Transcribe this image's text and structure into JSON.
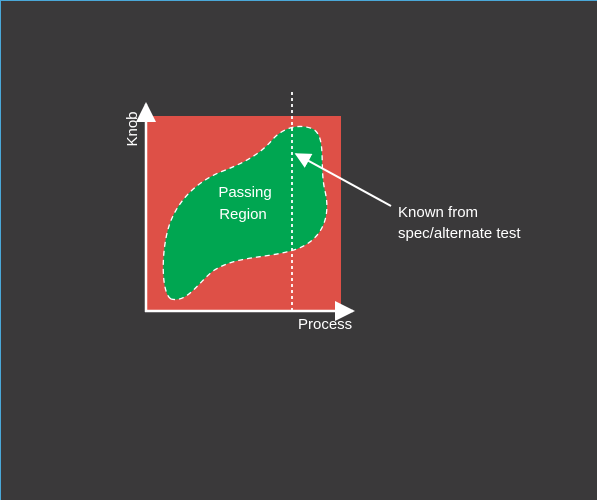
{
  "diagram": {
    "y_axis_label": "Knob",
    "x_axis_label": "Process",
    "region_label_line1": "Passing",
    "region_label_line2": "Region",
    "callout_line1": "Known from",
    "callout_line2": "spec/alternate test",
    "colors": {
      "background": "#3a393a",
      "fail_area": "#de5047",
      "passing_region": "#00a651",
      "axis": "#ffffff",
      "frame": "#4aa8d8"
    }
  }
}
